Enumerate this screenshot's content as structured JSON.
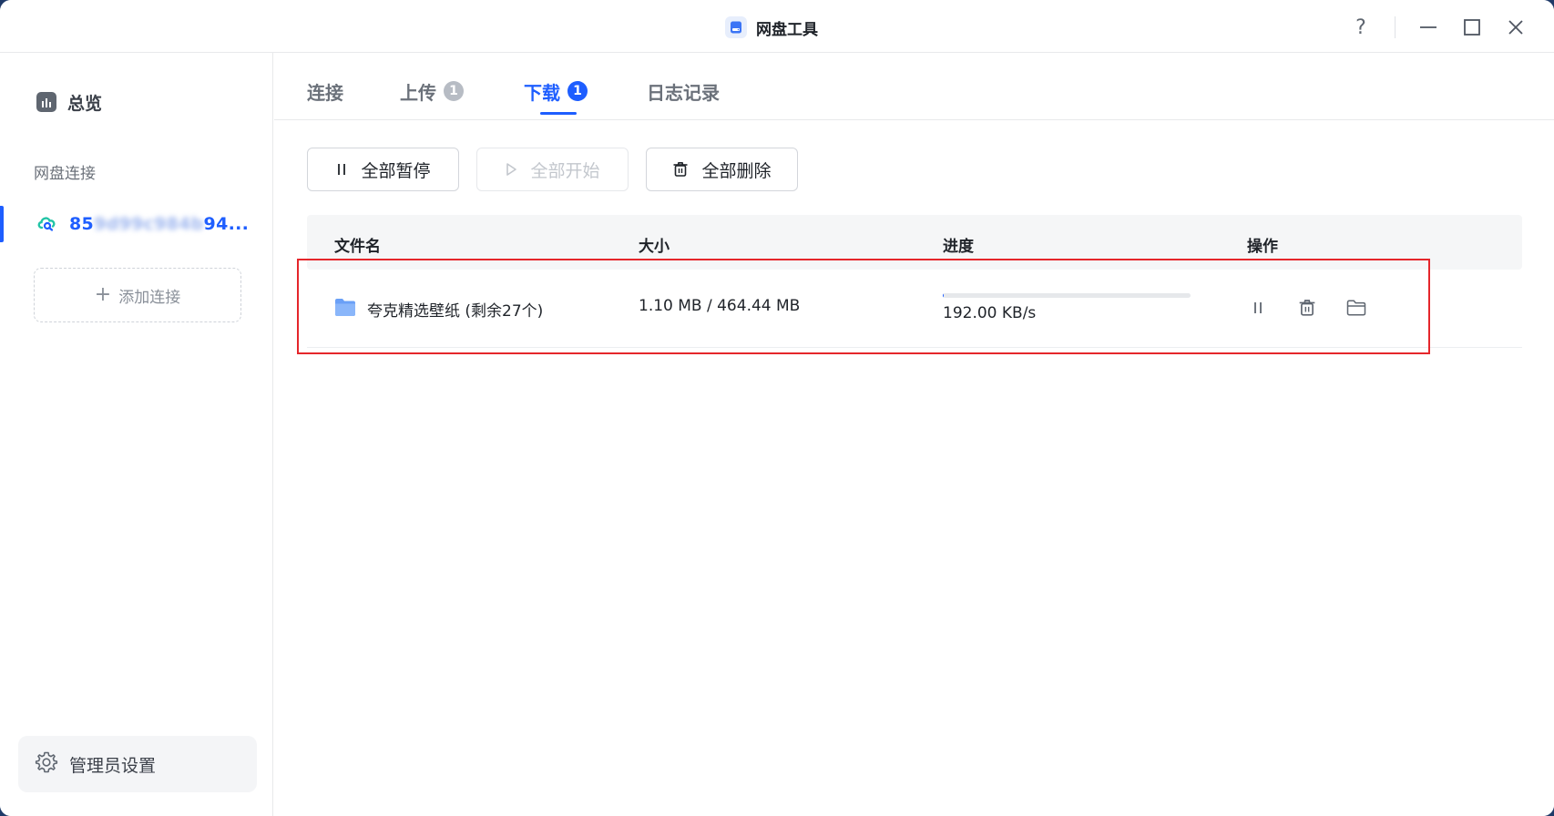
{
  "window": {
    "title": "网盘工具",
    "help_label": "?"
  },
  "sidebar": {
    "overview_label": "总览",
    "section_label": "网盘连接",
    "connection": {
      "prefix": "85",
      "blurred": "9d99c984b",
      "suffix": "94..."
    },
    "add_connection_label": "添加连接",
    "admin_label": "管理员设置"
  },
  "tabs": [
    {
      "label": "连接",
      "badge": null
    },
    {
      "label": "上传",
      "badge": "1"
    },
    {
      "label": "下载",
      "badge": "1"
    },
    {
      "label": "日志记录",
      "badge": null
    }
  ],
  "active_tab": "下载",
  "toolbar": {
    "pause_all": "全部暂停",
    "start_all": "全部开始",
    "delete_all": "全部删除"
  },
  "table": {
    "columns": [
      "文件名",
      "大小",
      "进度",
      "操作"
    ],
    "rows": [
      {
        "name": "夸克精选壁纸 (剩余27个)",
        "size": "1.10 MB / 464.44 MB",
        "progress_fraction": 0.0024,
        "speed": "192.00 KB/s"
      }
    ]
  },
  "colors": {
    "accent": "#1e5eff",
    "highlight": "#e5262b",
    "folder": "#6aa0f7"
  }
}
